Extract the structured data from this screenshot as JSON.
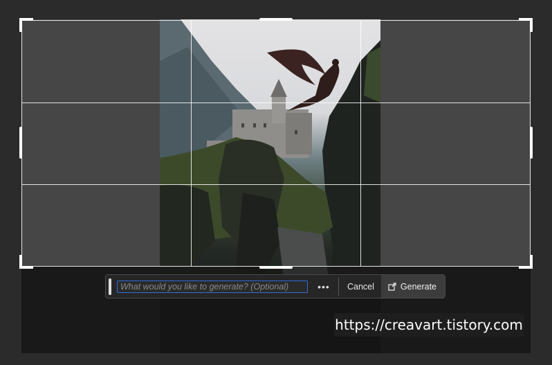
{
  "prompt_bar": {
    "placeholder": "What would you like to generate? (Optional)",
    "value": "",
    "more_label": "•••",
    "cancel_label": "Cancel",
    "generate_label": "Generate",
    "generate_icon": "generate-icon"
  },
  "watermark": {
    "text": "https://creavart.tistory.com"
  },
  "colors": {
    "background": "#2b2b2b",
    "mask": "#464646",
    "input_focus_border": "#2f6fd6",
    "toolbar_bg": "#262626"
  }
}
